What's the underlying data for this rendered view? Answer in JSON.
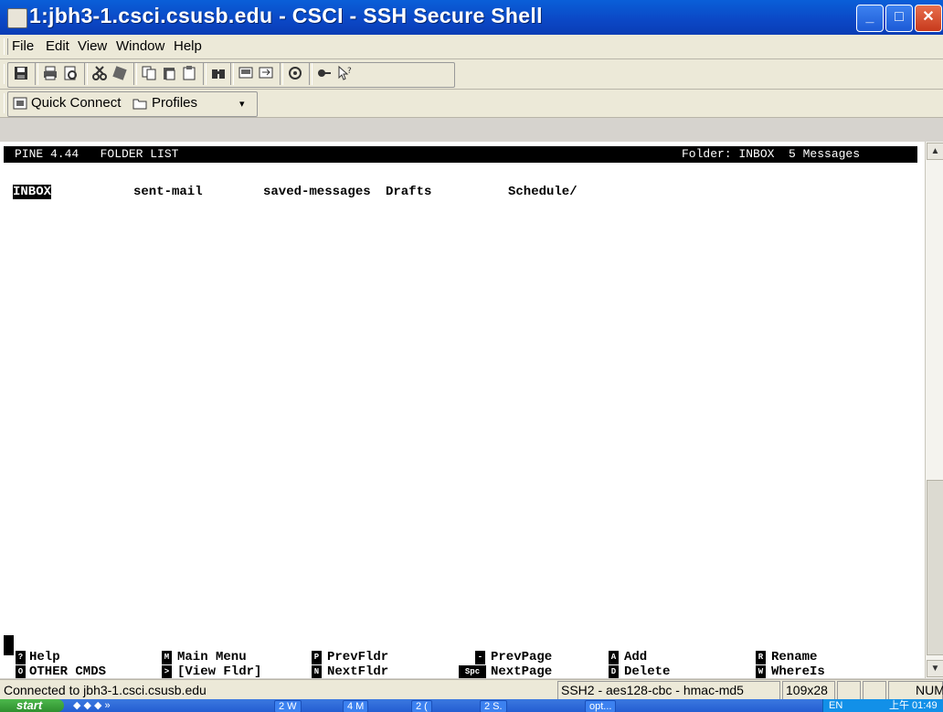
{
  "window": {
    "title": "1:jbh3-1.csci.csusb.edu - CSCI - SSH Secure Shell"
  },
  "menu": [
    "File",
    "Edit",
    "View",
    "Window",
    "Help"
  ],
  "quickbar": {
    "quick_connect": "Quick Connect",
    "profiles": "Profiles"
  },
  "terminal": {
    "header_left": "PINE 4.44   FOLDER LIST",
    "header_right": "Folder: INBOX  5 Messages",
    "folders": [
      "INBOX",
      "sent-mail",
      "saved-messages",
      "Drafts",
      "Schedule/"
    ],
    "commands": [
      {
        "key": "?",
        "label": "Help"
      },
      {
        "key": "O",
        "label": "OTHER CMDS"
      },
      {
        "key": "M",
        "label": "Main Menu"
      },
      {
        "key": ">",
        "label": "[View Fldr]"
      },
      {
        "key": "P",
        "label": "PrevFldr"
      },
      {
        "key": "N",
        "label": "NextFldr"
      },
      {
        "key": "-",
        "label": "PrevPage"
      },
      {
        "key": "Spc",
        "label": "NextPage"
      },
      {
        "key": "A",
        "label": "Add"
      },
      {
        "key": "D",
        "label": "Delete"
      },
      {
        "key": "R",
        "label": "Rename"
      },
      {
        "key": "W",
        "label": "WhereIs"
      }
    ]
  },
  "status": {
    "connection": "Connected to jbh3-1.csci.csusb.edu",
    "cipher": "SSH2 - aes128-cbc - hmac-md5",
    "size": "109x28",
    "num": "NUM"
  },
  "taskbar": {
    "start": "start",
    "items": [
      "2 W",
      "4 M",
      "2 (",
      "2 S.",
      "opt..."
    ],
    "lang": "EN",
    "clock": "上午 01:49"
  }
}
